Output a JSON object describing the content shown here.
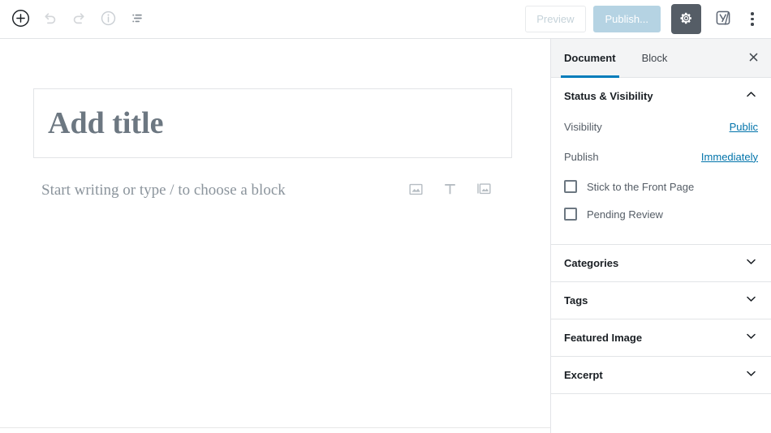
{
  "toolbar": {
    "left_buttons": [
      {
        "name": "add-block-icon",
        "label": "Add block"
      },
      {
        "name": "undo-icon",
        "label": "Undo"
      },
      {
        "name": "redo-icon",
        "label": "Redo"
      },
      {
        "name": "content-info-icon",
        "label": "Content structure"
      },
      {
        "name": "block-navigation-icon",
        "label": "Block navigation"
      }
    ],
    "preview_label": "Preview",
    "publish_label": "Publish...",
    "settings_gear_icon": "gear-icon",
    "yoast_icon": "yoast-seo-icon",
    "more_menu_icon": "kebab-menu-icon"
  },
  "editor": {
    "title_placeholder": "Add title",
    "block_placeholder": "Start writing or type / to choose a block",
    "quick_insert": [
      {
        "name": "image-block-icon",
        "label": "Image"
      },
      {
        "name": "paragraph-block-icon",
        "label": "Paragraph"
      },
      {
        "name": "gallery-block-icon",
        "label": "Gallery"
      }
    ]
  },
  "sidebar": {
    "tabs": [
      {
        "label": "Document",
        "active": true
      },
      {
        "label": "Block",
        "active": false
      }
    ],
    "close_icon": "close-icon",
    "status_panel": {
      "title": "Status & Visibility",
      "expanded": true,
      "toggle_icon": "chevron-up-icon",
      "rows": [
        {
          "label": "Visibility",
          "value": "Public"
        },
        {
          "label": "Publish",
          "value": "Immediately"
        }
      ],
      "checkboxes": [
        {
          "label": "Stick to the Front Page",
          "checked": false
        },
        {
          "label": "Pending Review",
          "checked": false
        }
      ]
    },
    "panels": [
      {
        "title": "Categories",
        "expanded": false,
        "toggle_icon": "chevron-down-icon"
      },
      {
        "title": "Tags",
        "expanded": false,
        "toggle_icon": "chevron-down-icon"
      },
      {
        "title": "Featured Image",
        "expanded": false,
        "toggle_icon": "chevron-down-icon"
      },
      {
        "title": "Excerpt",
        "expanded": false,
        "toggle_icon": "chevron-down-icon"
      }
    ]
  },
  "colors": {
    "accent_blue": "#007cba",
    "link_blue": "#0073aa",
    "gear_dark": "#555d66",
    "publish_disabled": "#b5d3e3"
  }
}
